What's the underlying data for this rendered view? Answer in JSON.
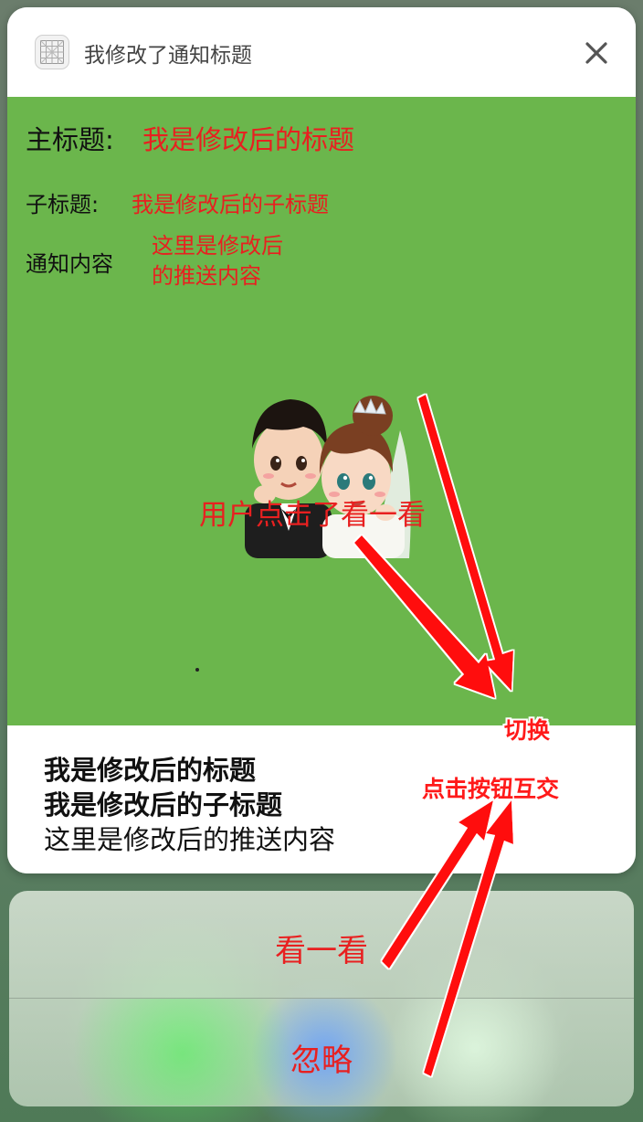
{
  "notification": {
    "app_title": "我修改了通知标题",
    "app_icon": "grid-icon",
    "close_icon": "close-icon"
  },
  "content": {
    "main_title_label": "主标题:",
    "main_title_value": "我是修改后的标题",
    "sub_title_label": "子标题:",
    "sub_title_value": "我是修改后的子标题",
    "body_label": "通知内容",
    "body_value_line1": "这里是修改后",
    "body_value_line2": "的推送内容",
    "image": "cartoon-couple-image",
    "clicked_text": "用户点击了看一看"
  },
  "summary": {
    "title": "我是修改后的标题",
    "subtitle": "我是修改后的子标题",
    "body": "这里是修改后的推送内容"
  },
  "actions": {
    "look_label": "看一看",
    "ignore_label": "忽略"
  },
  "annotations": {
    "switch": "切换",
    "interact": "点击按钮互交"
  },
  "colors": {
    "green": "#6bb64c",
    "annotation_red": "#e82020"
  }
}
